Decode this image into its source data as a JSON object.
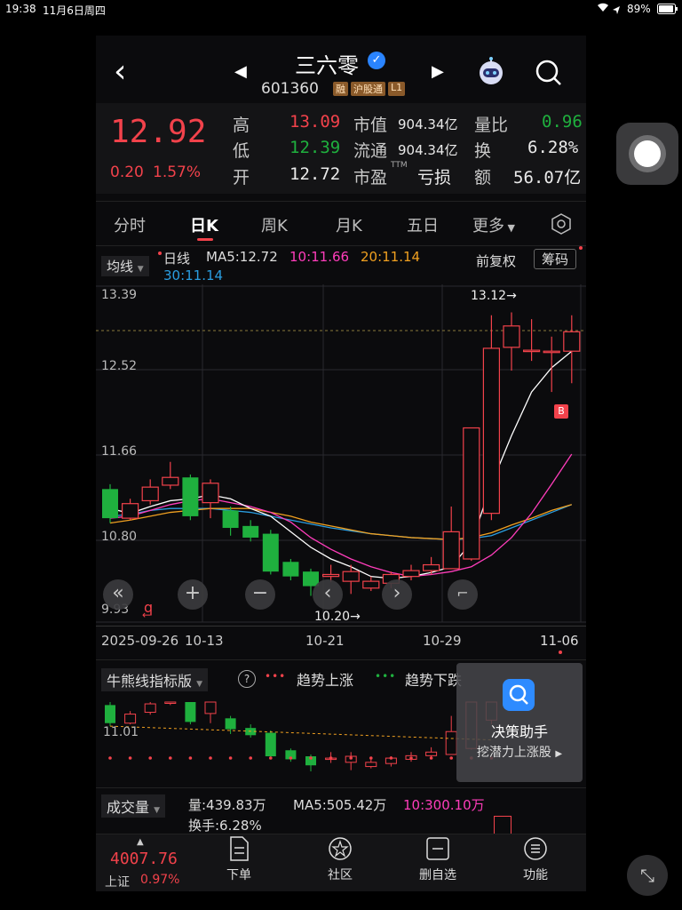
{
  "status": {
    "time": "19:38",
    "date": "11月6日周四",
    "battery": "89%"
  },
  "header": {
    "stock_name": "三六零",
    "stock_code": "601360",
    "badges": [
      "融",
      "沪股通",
      "L1"
    ],
    "icons": [
      "back-icon",
      "prev-icon",
      "next-icon",
      "robot-icon",
      "search-icon",
      "verified-icon"
    ]
  },
  "quote": {
    "price": "12.92",
    "change": "0.20",
    "change_pct": "1.57%",
    "high_label": "高",
    "high": "13.09",
    "low_label": "低",
    "low": "12.39",
    "open_label": "开",
    "open": "12.72",
    "mktcap_label": "市值",
    "mktcap": "904.34亿",
    "float_label": "流通",
    "float": "904.34亿",
    "pe_label": "市盈",
    "pe_sup": "TTM",
    "pe": "亏损",
    "volratio_label": "量比",
    "volratio": "0.96",
    "turnover_label": "换",
    "turnover": "6.28%",
    "amount_label": "额",
    "amount": "56.07亿"
  },
  "tabs": [
    "分时",
    "日K",
    "周K",
    "月K",
    "五日",
    "更多"
  ],
  "active_tab": "日K",
  "ma_legend": {
    "select": "均线",
    "day": "日线",
    "ma5": "MA5:12.72",
    "ma10": "10:11.66",
    "ma20": "20:11.14",
    "ma30": "30:11.14",
    "fuquan": "前复权",
    "chip": "筹码"
  },
  "price_axis": {
    "levels": [
      "13.39",
      "12.52",
      "11.66",
      "10.80",
      "9.93"
    ]
  },
  "annotations": {
    "high": "13.12→",
    "low": "10.20→",
    "buy": "B",
    "q": "q"
  },
  "date_axis": [
    "2025-09-26",
    "10-13",
    "10-21",
    "10-29",
    "11-06"
  ],
  "colors": {
    "up": "#f2424b",
    "down": "#1fb03e",
    "ma5": "#ffffff",
    "ma10": "#ff3dbb",
    "ma20": "#f0a020",
    "ma30": "#2a9de0"
  },
  "indicator": {
    "select": "牛熊线指标版",
    "help": "?",
    "up_text": "趋势上涨",
    "down_text": "趋势下跌",
    "level": "11.01"
  },
  "assistant": {
    "title": "决策助手",
    "sub": "挖潜力上涨股"
  },
  "volume": {
    "select": "成交量",
    "vol": "量:439.83万",
    "ma5": "MA5:505.42万",
    "ma10": "10:300.10万",
    "turnover": "换手:6.28%"
  },
  "bottom_nav": {
    "index_value": "4007.76",
    "index_name": "上证",
    "index_pct": "0.97%",
    "items": [
      "下单",
      "社区",
      "删自选",
      "功能"
    ]
  },
  "chart_data": {
    "type": "candlestick",
    "x": [
      "2025-09-26",
      "09-29",
      "09-30",
      "10-09",
      "10-10",
      "10-13",
      "10-14",
      "10-15",
      "10-16",
      "10-17",
      "10-20",
      "10-21",
      "10-22",
      "10-23",
      "10-24",
      "10-27",
      "10-28",
      "10-29",
      "10-30",
      "10-31",
      "11-03",
      "11-04",
      "11-05",
      "11-06"
    ],
    "open": [
      11.3,
      11.0,
      11.18,
      11.34,
      11.42,
      11.16,
      11.08,
      10.92,
      10.84,
      10.55,
      10.45,
      10.4,
      10.35,
      10.28,
      10.33,
      10.4,
      10.46,
      10.48,
      10.58,
      11.05,
      12.76,
      12.73,
      12.72,
      12.72
    ],
    "close": [
      11.0,
      11.15,
      11.32,
      11.42,
      11.02,
      11.36,
      10.9,
      10.8,
      10.45,
      10.4,
      10.3,
      10.42,
      10.45,
      10.35,
      10.42,
      10.46,
      10.52,
      10.86,
      11.93,
      12.75,
      12.98,
      12.73,
      12.72,
      12.92
    ],
    "high": [
      11.35,
      11.2,
      11.4,
      11.58,
      11.45,
      11.4,
      11.12,
      10.98,
      10.88,
      10.58,
      10.48,
      10.52,
      10.52,
      10.4,
      10.45,
      10.52,
      10.6,
      11.12,
      11.93,
      13.09,
      13.12,
      13.05,
      12.87,
      13.09
    ],
    "low": [
      10.95,
      10.98,
      11.14,
      11.3,
      10.98,
      11.0,
      10.82,
      10.76,
      10.42,
      10.36,
      10.2,
      10.34,
      10.22,
      10.25,
      10.28,
      10.36,
      10.42,
      10.48,
      10.56,
      10.98,
      12.52,
      12.62,
      12.3,
      12.39
    ],
    "ma5": [
      11.1,
      11.05,
      11.12,
      11.18,
      11.2,
      11.24,
      11.2,
      11.1,
      11.02,
      10.86,
      10.7,
      10.58,
      10.5,
      10.4,
      10.38,
      10.4,
      10.44,
      10.5,
      10.75,
      11.35,
      11.85,
      12.3,
      12.55,
      12.72
    ],
    "ma10": [
      11.0,
      11.02,
      11.08,
      11.14,
      11.18,
      11.2,
      11.16,
      11.12,
      11.06,
      10.96,
      10.8,
      10.68,
      10.58,
      10.5,
      10.44,
      10.4,
      10.42,
      10.45,
      10.5,
      10.62,
      10.8,
      11.05,
      11.35,
      11.66
    ],
    "ma20": [
      10.95,
      10.98,
      11.02,
      11.06,
      11.08,
      11.1,
      11.1,
      11.1,
      11.06,
      11.02,
      10.96,
      10.92,
      10.88,
      10.84,
      10.82,
      10.8,
      10.79,
      10.78,
      10.8,
      10.85,
      10.93,
      11.0,
      11.08,
      11.14
    ],
    "ma30": [
      11.02,
      11.04,
      11.08,
      11.1,
      11.1,
      11.1,
      11.08,
      11.06,
      11.02,
      10.98,
      10.94,
      10.9,
      10.87,
      10.84,
      10.82,
      10.8,
      10.79,
      10.78,
      10.79,
      10.82,
      10.9,
      10.98,
      11.06,
      11.14
    ],
    "ylim": [
      9.93,
      13.39
    ],
    "grid": true
  }
}
